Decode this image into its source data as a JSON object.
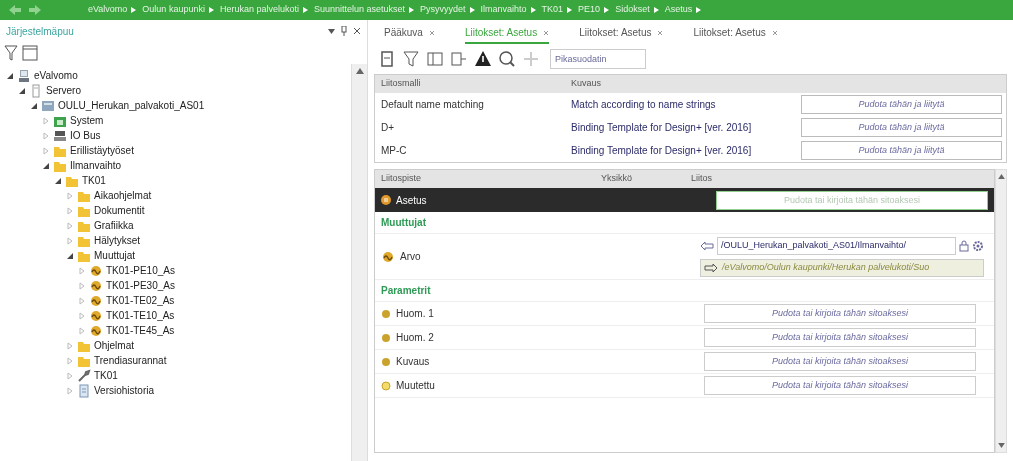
{
  "breadcrumb": [
    "eValvomo",
    "Oulun kaupunki",
    "Herukan palvelukoti",
    "Suunnittelun asetukset",
    "Pysyvyydet",
    "Ilmanvaihto",
    "TK01",
    "PE10",
    "Sidokset",
    "Asetus"
  ],
  "explorer": {
    "title": "Järjestelmäpuu",
    "tree": [
      {
        "label": "eValvomo",
        "kind": "computer",
        "expanded": true,
        "children": [
          {
            "label": "Servero",
            "kind": "server",
            "expanded": true,
            "children": [
              {
                "label": "OULU_Herukan_palvakoti_AS01",
                "kind": "device",
                "expanded": true,
                "children": [
                  {
                    "label": "System",
                    "kind": "system",
                    "expanded": false
                  },
                  {
                    "label": "IO Bus",
                    "kind": "bus",
                    "expanded": false
                  },
                  {
                    "label": "Erillistäytyöset",
                    "kind": "folder",
                    "expanded": false
                  },
                  {
                    "label": "Ilmanvaihto",
                    "kind": "folder",
                    "expanded": true,
                    "children": [
                      {
                        "label": "TK01",
                        "kind": "folder",
                        "expanded": true,
                        "children": [
                          {
                            "label": "Aikaohjelmat",
                            "kind": "folder",
                            "expanded": false
                          },
                          {
                            "label": "Dokumentit",
                            "kind": "folder",
                            "expanded": false
                          },
                          {
                            "label": "Grafiikka",
                            "kind": "folder",
                            "expanded": false
                          },
                          {
                            "label": "Hälytykset",
                            "kind": "folder",
                            "expanded": false
                          },
                          {
                            "label": "Muuttujat",
                            "kind": "folder",
                            "expanded": true,
                            "children": [
                              {
                                "label": "TK01-PE10_As",
                                "kind": "variable",
                                "expanded": false
                              },
                              {
                                "label": "TK01-PE30_As",
                                "kind": "variable",
                                "expanded": false
                              },
                              {
                                "label": "TK01-TE02_As",
                                "kind": "variable",
                                "expanded": false
                              },
                              {
                                "label": "TK01-TE10_As",
                                "kind": "variable",
                                "expanded": false
                              },
                              {
                                "label": "TK01-TE45_As",
                                "kind": "variable",
                                "expanded": false
                              }
                            ]
                          },
                          {
                            "label": "Ohjelmat",
                            "kind": "folder",
                            "expanded": false
                          },
                          {
                            "label": "Trendiasurannat",
                            "kind": "folder",
                            "expanded": false
                          },
                          {
                            "label": "TK01",
                            "kind": "tool",
                            "expanded": false
                          },
                          {
                            "label": "Versiohistoria",
                            "kind": "document",
                            "expanded": false
                          }
                        ]
                      }
                    ]
                  }
                ]
              }
            ]
          }
        ]
      }
    ]
  },
  "tabs": [
    {
      "label": "Pääkuva",
      "selected": false
    },
    {
      "label": "Liitokset: Asetus",
      "selected": true
    },
    {
      "label": "Liitokset: Asetus",
      "selected": false
    },
    {
      "label": "Liitokset: Asetus",
      "selected": false
    }
  ],
  "quick_filter": {
    "placeholder": "Pikasuodatin"
  },
  "templates": {
    "columns": [
      "Liitosmalli",
      "Kuvaus"
    ],
    "rows": [
      {
        "name": "Default name matching",
        "description": "Match according to name strings",
        "drop_placeholder": "Pudota tähän ja liitytä"
      },
      {
        "name": "D+",
        "description": "Binding Template for Design+ [ver. 2016]",
        "drop_placeholder": "Pudota tähän ja liitytä"
      },
      {
        "name": "MP-C",
        "description": "Binding Template for Design+ [ver. 2016]",
        "drop_placeholder": "Pudota tähän ja liitytä"
      }
    ]
  },
  "bindings": {
    "columns": [
      "Liitospiste",
      "Yksikkö",
      "Liitos"
    ],
    "header_row": {
      "label": "Asetus",
      "placeholder": "Pudota tai kirjoita tähän sitoaksesi"
    },
    "sections": [
      {
        "title": "Muuttujat",
        "rows": [
          {
            "label": "Arvo",
            "kind": "variable",
            "binding_in": "/OULU_Herukan_palvakoti_AS01/Ilmanvaihto/",
            "binding_out": "/eValvomo/Oulun kaupunki/Herukan palvelukoti/Suo"
          }
        ]
      },
      {
        "title": "Parametrit",
        "rows": [
          {
            "label": "Huom. 1",
            "kind": "parameter",
            "placeholder": "Pudota tai kirjoita tähän sitoaksesi"
          },
          {
            "label": "Huom. 2",
            "kind": "parameter",
            "placeholder": "Pudota tai kirjoita tähän sitoaksesi"
          },
          {
            "label": "Kuvaus",
            "kind": "parameter",
            "placeholder": "Pudota tai kirjoita tähän sitoaksesi"
          },
          {
            "label": "Muutettu",
            "kind": "parameter-unset",
            "placeholder": "Pudota tai kirjoita tähän sitoaksesi"
          }
        ]
      }
    ]
  }
}
